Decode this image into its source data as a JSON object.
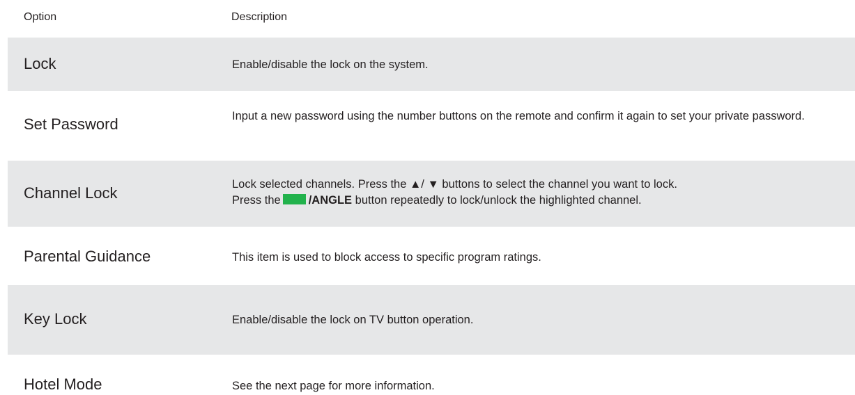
{
  "header": {
    "option": "Option",
    "description": "Description"
  },
  "rows": [
    {
      "option": "Lock",
      "description": "Enable/disable the lock on the system."
    },
    {
      "option": "Set Password",
      "description": "Input a new password using the number buttons on the remote and confirm it again to set your private password."
    },
    {
      "option": "Channel Lock",
      "description_line1": "Lock selected channels. Press the  ▲/ ▼  buttons to select the channel you want to lock.",
      "description_line2_prefix": "Press the",
      "description_line2_button": "/ANGLE",
      "description_line2_suffix": "button repeatedly to lock/unlock the highlighted channel.",
      "button_color": "#22b24c"
    },
    {
      "option": "Parental Guidance",
      "description": "This item is used to block access to specific program ratings."
    },
    {
      "option": "Key Lock",
      "description": "Enable/disable the lock on TV button operation."
    },
    {
      "option": "Hotel Mode",
      "description": "See the next page for more information."
    }
  ]
}
